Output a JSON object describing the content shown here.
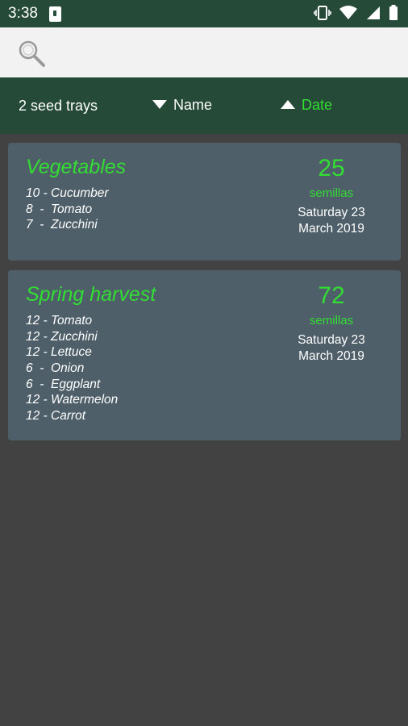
{
  "status_bar": {
    "time": "3:38",
    "icons": [
      "notification-icon",
      "vibrate-icon",
      "wifi-icon",
      "signal-icon",
      "battery-icon"
    ]
  },
  "search": {
    "placeholder": "",
    "icon": "search-icon"
  },
  "sort_bar": {
    "count_label": "2 seed trays",
    "name_label": "Name",
    "name_direction": "descending",
    "date_label": "Date",
    "date_direction": "ascending",
    "active_sort": "Date"
  },
  "colors": {
    "primary_dark": "#264a38",
    "accent": "#33dd33",
    "background": "#424242",
    "card": "#4e5f69"
  },
  "trays": [
    {
      "title": "Vegetables",
      "seeds": [
        "10 - Cucumber",
        "8  -  Tomato",
        "7  -  Zucchini"
      ],
      "count": "25",
      "unit": "semillas",
      "date_line1": "Saturday 23",
      "date_line2": "March 2019"
    },
    {
      "title": "Spring harvest",
      "seeds": [
        "12 - Tomato",
        "12 - Zucchini",
        "12 - Lettuce",
        "6  -  Onion",
        "6  -  Eggplant",
        "12 - Watermelon",
        "12 - Carrot"
      ],
      "count": "72",
      "unit": "semillas",
      "date_line1": "Saturday 23",
      "date_line2": "March 2019"
    }
  ]
}
